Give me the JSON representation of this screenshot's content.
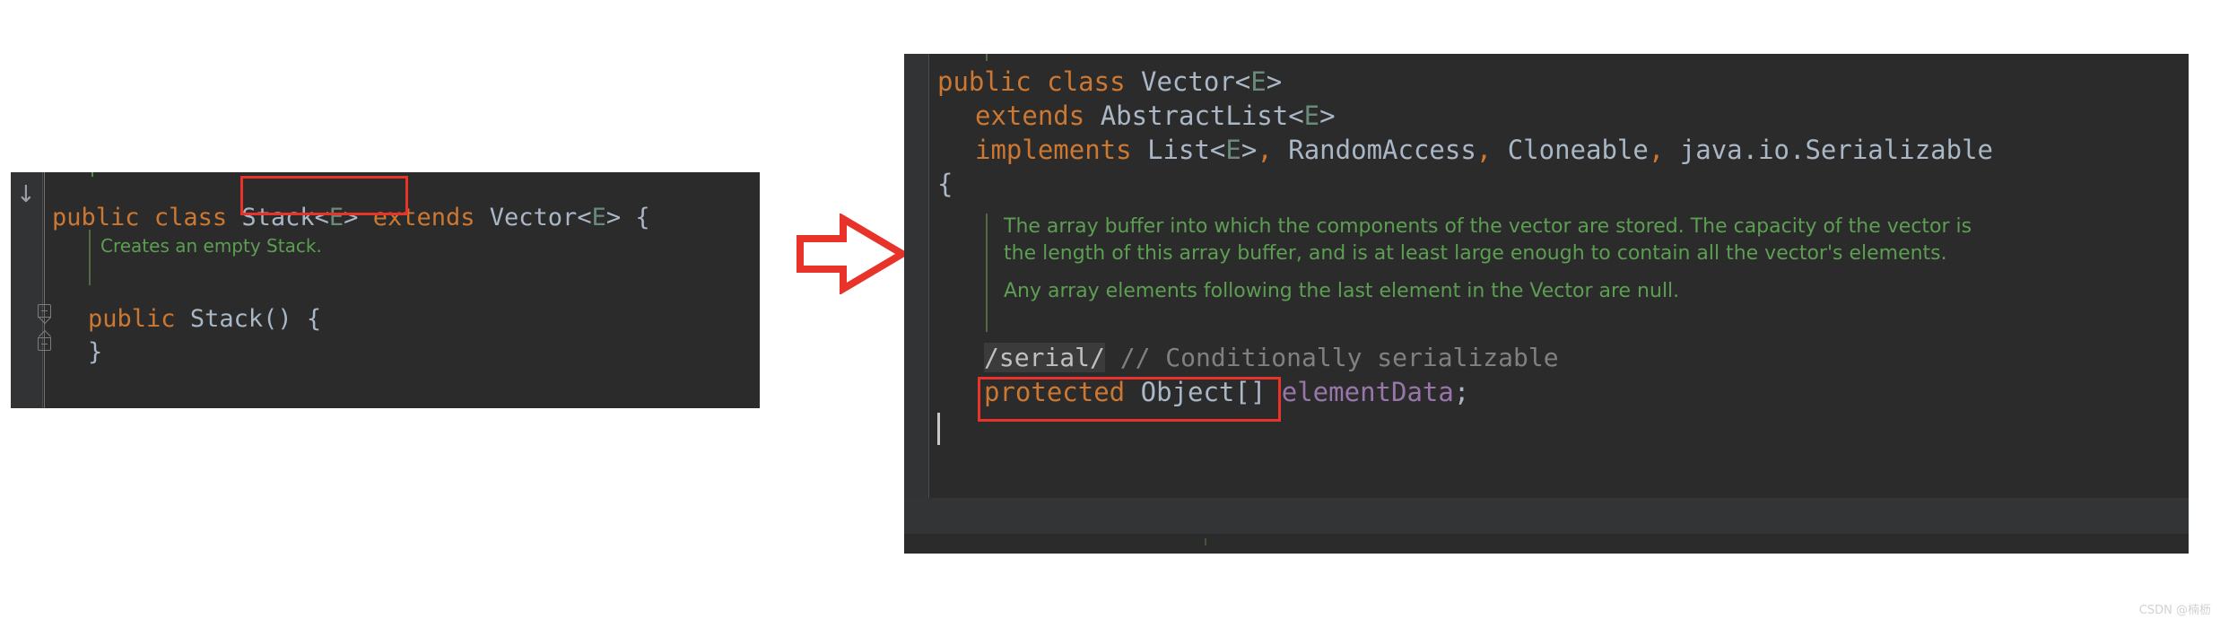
{
  "watermark": "CSDN @楠枥",
  "colors": {
    "editor_bg": "#2b2b2b",
    "gutter_bg": "#313335",
    "keyword": "#cc7832",
    "identifier": "#a9b7c6",
    "generic": "#6a8a7b",
    "field": "#9876aa",
    "comment": "#808080",
    "javadoc": "#629755",
    "highlight_box": "#e8332a",
    "arrow": "#e8332a"
  },
  "left_editor": {
    "name": "stack-source-editor",
    "gutter": {
      "down_arrow_icon": "↓"
    },
    "code": {
      "l1": {
        "kw_public": "public",
        "kw_class": "class",
        "name": "Stack",
        "lt": "<",
        "generic": "E",
        "gt": ">",
        "kw_extends": "extends",
        "super": "Vector",
        "lt2": "<",
        "generic2": "E",
        "gt2": ">",
        "brace": "{"
      },
      "javadoc": "Creates an empty Stack.",
      "l3": {
        "kw_public": "public",
        "ctor": "Stack",
        "parens": "()",
        "brace": "{"
      },
      "l4": {
        "brace": "}"
      }
    },
    "highlight_label": "extends Vector<E>"
  },
  "right_editor": {
    "name": "vector-source-editor",
    "code": {
      "l1": {
        "kw_public": "public",
        "kw_class": "class",
        "name": "Vector",
        "lt": "<",
        "generic": "E",
        "gt": ">"
      },
      "l2": {
        "kw_extends": "extends",
        "super": "AbstractList",
        "lt": "<",
        "generic": "E",
        "gt": ">"
      },
      "l3": {
        "kw_implements": "implements",
        "iface1": "List",
        "lt": "<",
        "generic": "E",
        "gt": ">",
        "comma1": ",",
        "iface2": "RandomAccess",
        "comma2": ",",
        "iface3": "Cloneable",
        "comma3": ",",
        "iface4": "java.io.Serializable"
      },
      "l4": {
        "brace": "{"
      },
      "javadoc_p1": "The array buffer into which the components of the vector are stored. The capacity of the vector is",
      "javadoc_p1b": "the length of this array buffer, and is at least large enough to contain all the vector's elements.",
      "javadoc_p2": "Any array elements following the last element in the Vector are null.",
      "l_serial": {
        "tag": "/serial/",
        "comment": "// Conditionally serializable"
      },
      "l_field": {
        "kw_protected": "protected",
        "type": "Object[]",
        "field": "elementData",
        "semi": ";"
      }
    },
    "highlight_label": "protected Object[] elementData;"
  },
  "arrow": {
    "name": "right-arrow-annotation",
    "direction": "right"
  }
}
